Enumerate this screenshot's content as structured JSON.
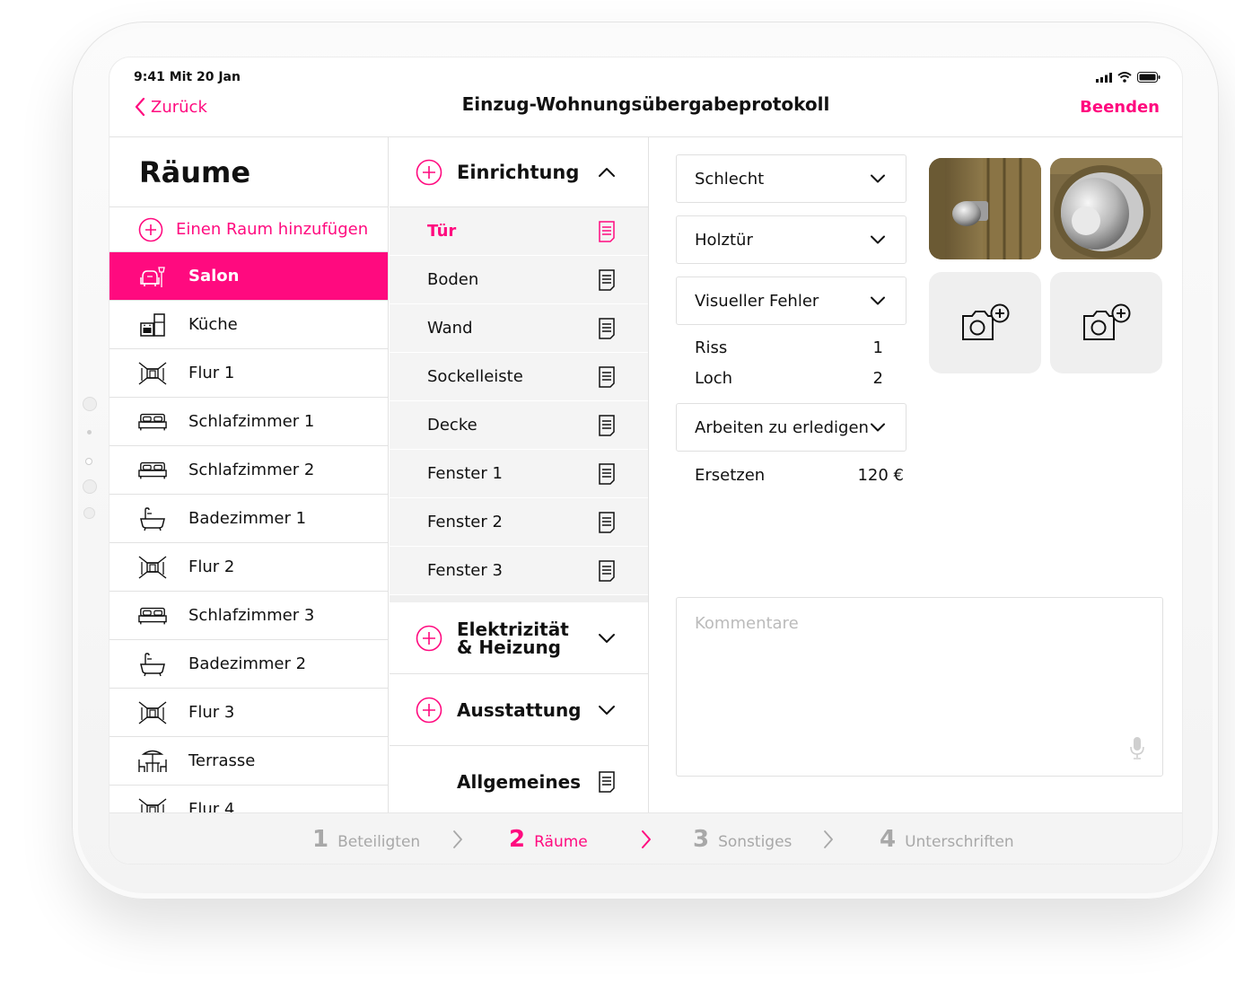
{
  "status": {
    "time": "9:41 Mit 20 Jan"
  },
  "nav": {
    "back": "Zurück",
    "title": "Einzug-Wohnungsübergabeprotokoll",
    "end": "Beenden"
  },
  "rooms": {
    "title": "Räume",
    "add": "Einen Raum hinzufügen",
    "items": [
      {
        "label": "Salon",
        "icon": "armchair-lamp-icon"
      },
      {
        "label": "Küche",
        "icon": "kitchen-icon"
      },
      {
        "label": "Flur 1",
        "icon": "hallway-icon"
      },
      {
        "label": "Schlafzimmer 1",
        "icon": "bed-icon"
      },
      {
        "label": "Schlafzimmer 2",
        "icon": "bed-icon"
      },
      {
        "label": "Badezimmer 1",
        "icon": "bathtub-icon"
      },
      {
        "label": "Flur 2",
        "icon": "hallway-icon"
      },
      {
        "label": "Schlafzimmer 3",
        "icon": "bed-icon"
      },
      {
        "label": "Badezimmer 2",
        "icon": "bathtub-icon"
      },
      {
        "label": "Flur 3",
        "icon": "hallway-icon"
      },
      {
        "label": "Terrasse",
        "icon": "terrace-icon"
      },
      {
        "label": "Flur 4",
        "icon": "hallway-icon"
      }
    ]
  },
  "categories": {
    "einrichtung": "Einrichtung",
    "items": [
      "Tür",
      "Boden",
      "Wand",
      "Sockelleiste",
      "Decke",
      "Fenster 1",
      "Fenster 2",
      "Fenster 3"
    ],
    "elektro_line1": "Elektrizität",
    "elektro_line2": "& Heizung",
    "ausstattung": "Ausstattung",
    "allgemeines": "Allgemeines"
  },
  "details": {
    "condition": "Schlecht",
    "material": "Holztür",
    "defect": "Visueller Fehler",
    "defects": [
      {
        "label": "Riss",
        "value": "1"
      },
      {
        "label": "Loch",
        "value": "2"
      }
    ],
    "work": "Arbeiten zu erledigen",
    "replace_label": "Ersetzen",
    "replace_value": "120 €",
    "comments_placeholder": "Kommentare"
  },
  "stepper": [
    {
      "num": "1",
      "label": "Beteiligten"
    },
    {
      "num": "2",
      "label": "Räume"
    },
    {
      "num": "3",
      "label": "Sonstiges"
    },
    {
      "num": "4",
      "label": "Unterschriften"
    }
  ],
  "colors": {
    "accent": "#ff0a7f",
    "muted": "#a8a8a8",
    "panel": "#f4f4f4"
  }
}
